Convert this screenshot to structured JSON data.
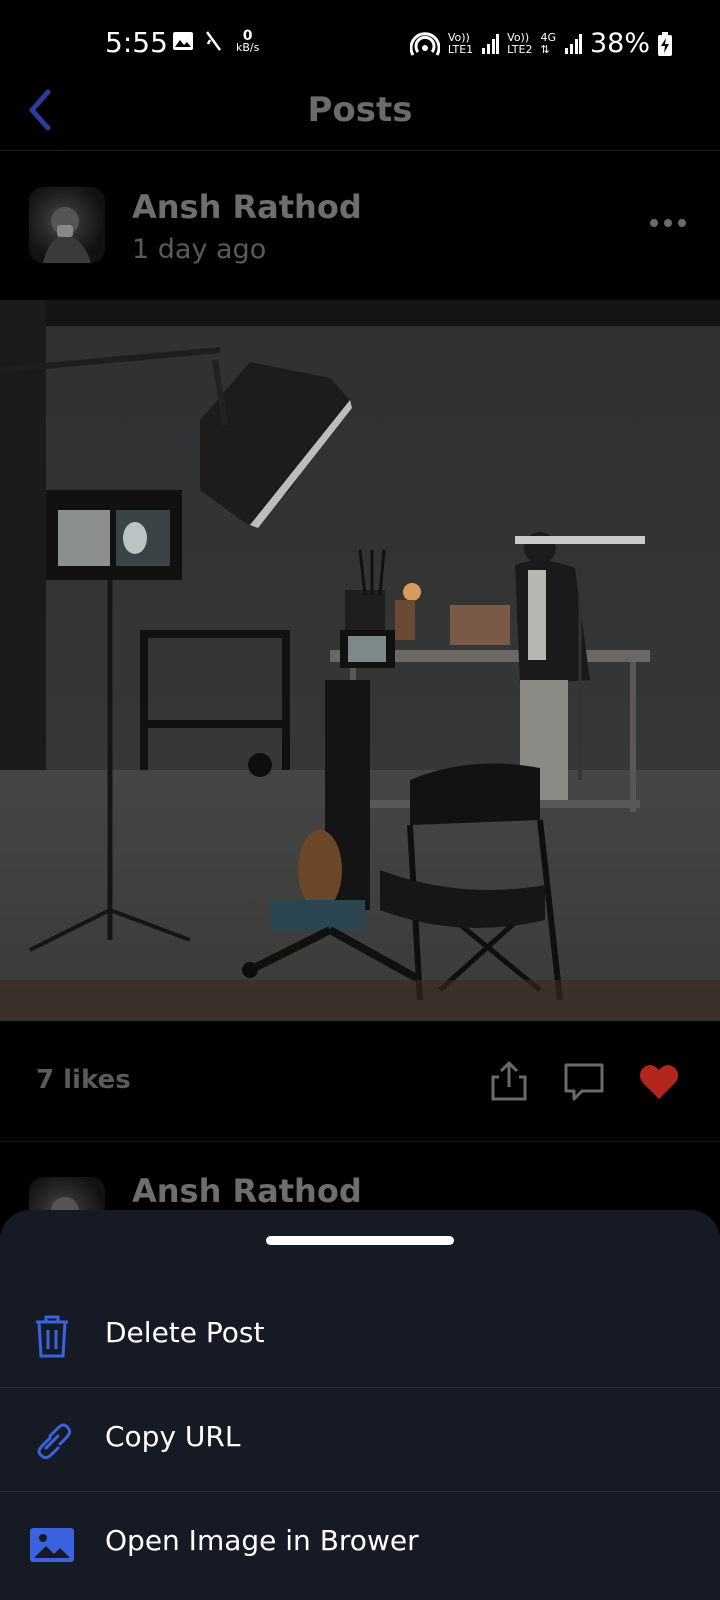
{
  "status_bar": {
    "time": "5:55",
    "speed_value": "0",
    "speed_unit": "kB/s",
    "sim1": "LTE1",
    "sim2": "LTE2",
    "sim2_tech": "4G",
    "volte": "Vo))",
    "battery": "38%"
  },
  "header": {
    "title": "Posts",
    "back_icon": "chevron-left-icon"
  },
  "post": {
    "author": "Ansh Rathod",
    "time": "1 day ago",
    "likes": "7 likes",
    "image_description_icon": "photo",
    "actions": [
      "share-icon",
      "comment-icon",
      "heart-icon"
    ]
  },
  "post2": {
    "author": "Ansh Rathod"
  },
  "sheet": {
    "items": [
      {
        "label": "Delete Post",
        "icon": "trash-icon"
      },
      {
        "label": "Copy URL",
        "icon": "link-icon"
      },
      {
        "label": "Open Image in Brower",
        "icon": "image-icon"
      }
    ]
  },
  "colors": {
    "accent": "#3b63e0",
    "background": "#000000",
    "sheet": "#161a25",
    "heart": "#b3261e"
  }
}
